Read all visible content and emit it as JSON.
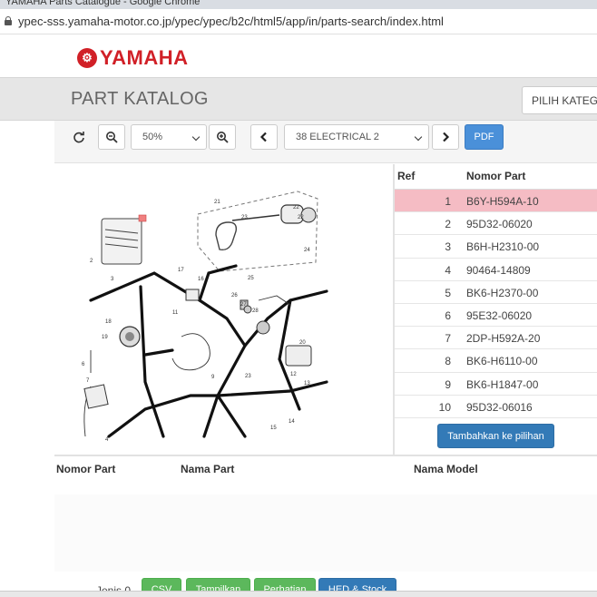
{
  "browser": {
    "window_title": "YAMAHA Parts Catalogue - Google Chrome",
    "url": "ypec-sss.yamaha-motor.co.jp/ypec/ypec/b2c/html5/app/in/parts-search/index.html"
  },
  "header": {
    "logo_text": "YAMAHA",
    "title": "PART KATALOG",
    "category_select": "PILIH KATEGORI"
  },
  "toolbar": {
    "zoom_value": "50%",
    "page_select": "38 ELECTRICAL 2",
    "pdf_label": "PDF"
  },
  "diagram": {
    "callouts": [
      "1",
      "2",
      "3",
      "4",
      "5",
      "6",
      "7",
      "8",
      "9",
      "10",
      "11",
      "12",
      "13",
      "14",
      "15",
      "16",
      "17",
      "18",
      "19",
      "20",
      "21",
      "22",
      "23",
      "24",
      "25",
      "26",
      "27",
      "28"
    ]
  },
  "parts_table": {
    "headers": {
      "ref": "Ref",
      "part_number": "Nomor Part"
    },
    "rows": [
      {
        "ref": "1",
        "part": "B6Y-H594A-10",
        "selected": true
      },
      {
        "ref": "2",
        "part": "95D32-06020",
        "selected": false
      },
      {
        "ref": "3",
        "part": "B6H-H2310-00",
        "selected": false
      },
      {
        "ref": "4",
        "part": "90464-14809",
        "selected": false
      },
      {
        "ref": "5",
        "part": "BK6-H2370-00",
        "selected": false
      },
      {
        "ref": "6",
        "part": "95E32-06020",
        "selected": false
      },
      {
        "ref": "7",
        "part": "2DP-H592A-20",
        "selected": false
      },
      {
        "ref": "8",
        "part": "BK6-H6110-00",
        "selected": false
      },
      {
        "ref": "9",
        "part": "BK6-H1847-00",
        "selected": false
      },
      {
        "ref": "10",
        "part": "95D32-06016",
        "selected": false
      }
    ],
    "add_button": "Tambahkan ke pilihan"
  },
  "bottom": {
    "headers": {
      "part_number": "Nomor Part",
      "part_name": "Nama Part",
      "model_name": "Nama Model"
    },
    "jenis_label": "Jenis",
    "jenis_count": "0",
    "buttons": {
      "csv": "CSV",
      "show": "Tampilkan",
      "attention": "Perhatian",
      "hed_stock": "HED & Stock"
    }
  },
  "colors": {
    "brand_red": "#d12027",
    "selected_row": "#f5bcc4",
    "primary_blue": "#337ab7",
    "success_green": "#5cb85c"
  }
}
